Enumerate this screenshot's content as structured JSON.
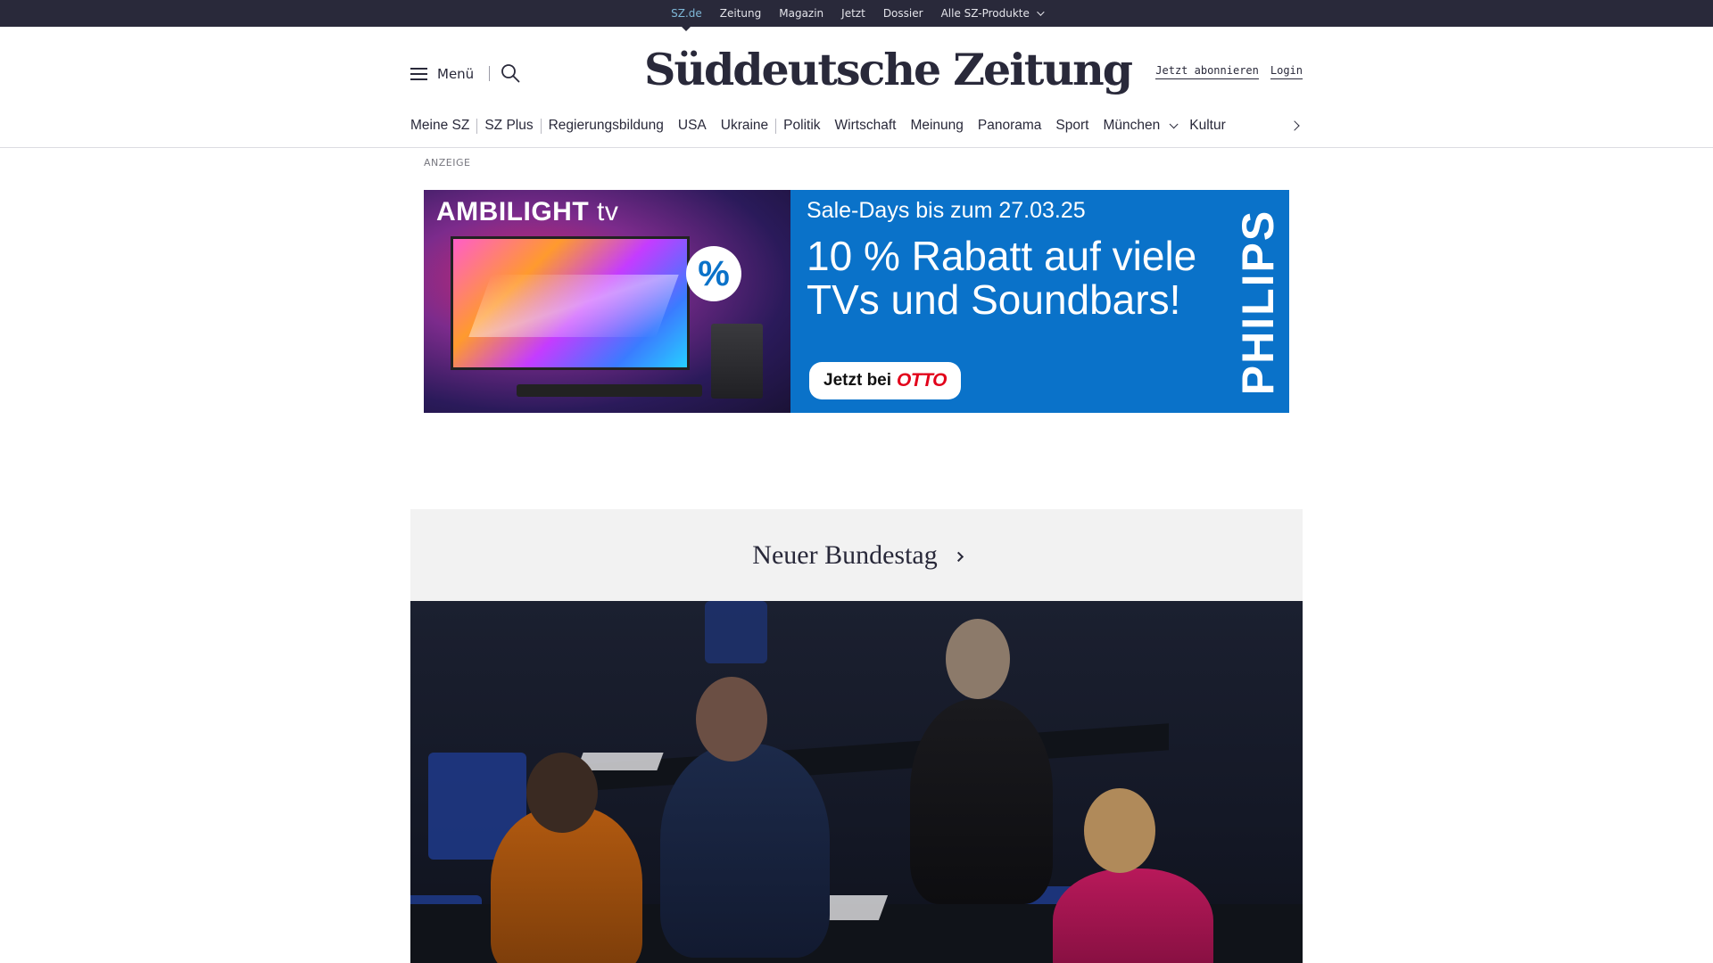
{
  "topbar": {
    "links": [
      "SZ.de",
      "Zeitung",
      "Magazin",
      "Jetzt",
      "Dossier"
    ],
    "products_label": "Alle SZ-Produkte",
    "active_index": 0
  },
  "header": {
    "menu_label": "Menü",
    "logo_text": "Süddeutsche Zeitung",
    "subscribe_label": "Jetzt abonnieren",
    "login_label": "Login"
  },
  "sections": {
    "items": [
      "Meine SZ",
      "SZ Plus",
      "Regierungsbildung",
      "USA",
      "Ukraine",
      "Politik",
      "Wirtschaft",
      "Meinung",
      "Panorama",
      "Sport",
      "München",
      "Kultur"
    ]
  },
  "ad": {
    "label": "ANZEIGE",
    "brand": "AMBILIGHT",
    "brand_suffix": "tv",
    "badge": "%",
    "sale_text": "Sale-Days bis zum 27.03.25",
    "headline": "10 % Rabatt auf viele TVs und Soundbars!",
    "cta_prefix": "Jetzt bei",
    "cta_partner": "OTTO",
    "advertiser": "PHILIPS",
    "colors": {
      "panel": "#0a72c9",
      "partner": "#e2001a"
    }
  },
  "topic": {
    "label": "Neuer Bundestag"
  },
  "colors": {
    "topbar_bg": "#29293a",
    "active_link": "#7fb8d8",
    "text": "#29293a",
    "topic_bg": "#f2f2f2"
  }
}
